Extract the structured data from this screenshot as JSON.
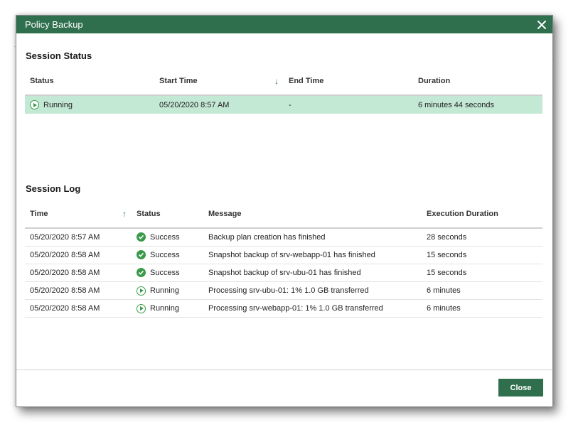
{
  "dialog": {
    "title": "Policy Backup",
    "close_button": "Close"
  },
  "session_status": {
    "title": "Session Status",
    "columns": [
      "Status",
      "Start Time",
      "End Time",
      "Duration"
    ],
    "row": {
      "status": "Running",
      "start_time": "05/20/2020 8:57 AM",
      "end_time": "-",
      "duration": "6 minutes 44 seconds"
    }
  },
  "session_log": {
    "title": "Session Log",
    "columns": [
      "Time",
      "Status",
      "Message",
      "Execution Duration"
    ],
    "rows": [
      {
        "time": "05/20/2020 8:57 AM",
        "status": "Success",
        "message": "Backup plan creation has finished",
        "duration": "28 seconds"
      },
      {
        "time": "05/20/2020 8:58 AM",
        "status": "Success",
        "message": "Snapshot backup of srv-webapp-01 has finished",
        "duration": "15 seconds"
      },
      {
        "time": "05/20/2020 8:58 AM",
        "status": "Success",
        "message": "Snapshot backup of srv-ubu-01 has finished",
        "duration": "15 seconds"
      },
      {
        "time": "05/20/2020 8:58 AM",
        "status": "Running",
        "message": "Processing srv-ubu-01: 1% 1.0 GB transferred",
        "duration": "6 minutes"
      },
      {
        "time": "05/20/2020 8:58 AM",
        "status": "Running",
        "message": "Processing srv-webapp-01: 1% 1.0 GB transferred",
        "duration": "6 minutes"
      }
    ]
  },
  "colors": {
    "accent": "#2f6f4e",
    "running_row": "#c3e8d4",
    "success_icon": "#3a9a4a"
  }
}
